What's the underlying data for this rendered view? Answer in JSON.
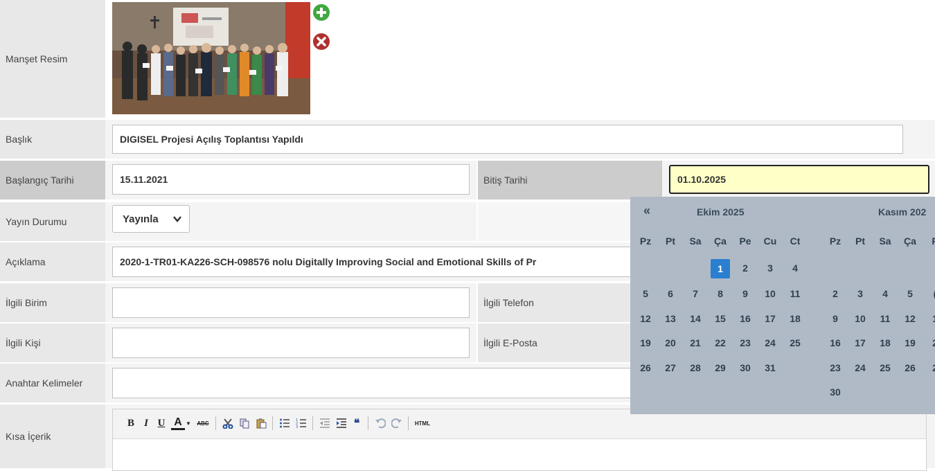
{
  "form": {
    "manset_label": "Manşet Resim",
    "baslik_label": "Başlık",
    "baslik_value": "DIGISEL Projesi Açılış Toplantısı Yapıldı",
    "baslangic_label": "Başlangıç Tarihi",
    "baslangic_value": "15.11.2021",
    "bitis_label": "Bitiş Tarihi",
    "bitis_value": "01.10.2025",
    "yayin_label": "Yayın Durumu",
    "yayin_value": "Yayınla",
    "aciklama_label": "Açıklama",
    "aciklama_value": "2020-1-TR01-KA226-SCH-098576 nolu Digitally Improving Social and Emotional Skills of Pr",
    "birim_label": "İlgili Birim",
    "birim_value": "",
    "telefon_label": "İlgili Telefon",
    "kisi_label": "İlgili Kişi",
    "kisi_value": "",
    "eposta_label": "İlgili E-Posta",
    "anahtar_label": "Anahtar Kelimeler",
    "anahtar_value": "",
    "kisa_label": "Kısa İçerik"
  },
  "icons": {
    "add": "plus-circle-icon",
    "remove": "close-circle-icon"
  },
  "colors": {
    "add_green": "#3fa83f",
    "remove_red": "#b03030",
    "focus_bg": "#ffffc8",
    "datepicker_bg": "#b0bac6",
    "selected_day": "#2a7fd0"
  },
  "datepicker": {
    "prev": "«",
    "month1_title": "Ekim 2025",
    "month2_title": "Kasım 202",
    "weekdays": [
      "Pz",
      "Pt",
      "Sa",
      "Ça",
      "Pe",
      "Cu",
      "Ct"
    ],
    "month2_weekdays": [
      "Pz",
      "Pt",
      "Sa",
      "Ça",
      "P"
    ],
    "month1_weeks": [
      [
        "",
        "",
        "",
        "1",
        "2",
        "3",
        "4"
      ],
      [
        "5",
        "6",
        "7",
        "8",
        "9",
        "10",
        "11"
      ],
      [
        "12",
        "13",
        "14",
        "15",
        "16",
        "17",
        "18"
      ],
      [
        "19",
        "20",
        "21",
        "22",
        "23",
        "24",
        "25"
      ],
      [
        "26",
        "27",
        "28",
        "29",
        "30",
        "31",
        ""
      ]
    ],
    "month2_weeks": [
      [
        "",
        "",
        "",
        "",
        ""
      ],
      [
        "2",
        "3",
        "4",
        "5",
        "("
      ],
      [
        "9",
        "10",
        "11",
        "12",
        "1"
      ],
      [
        "16",
        "17",
        "18",
        "19",
        "2"
      ],
      [
        "23",
        "24",
        "25",
        "26",
        "2"
      ],
      [
        "30",
        "",
        "",
        "",
        ""
      ]
    ],
    "selected_day": "1"
  },
  "editor_toolbar": {
    "bold": "B",
    "italic": "I",
    "underline": "U",
    "font_color": "A",
    "spellcheck": "ABC",
    "quote": "❝",
    "html": "HTML"
  }
}
